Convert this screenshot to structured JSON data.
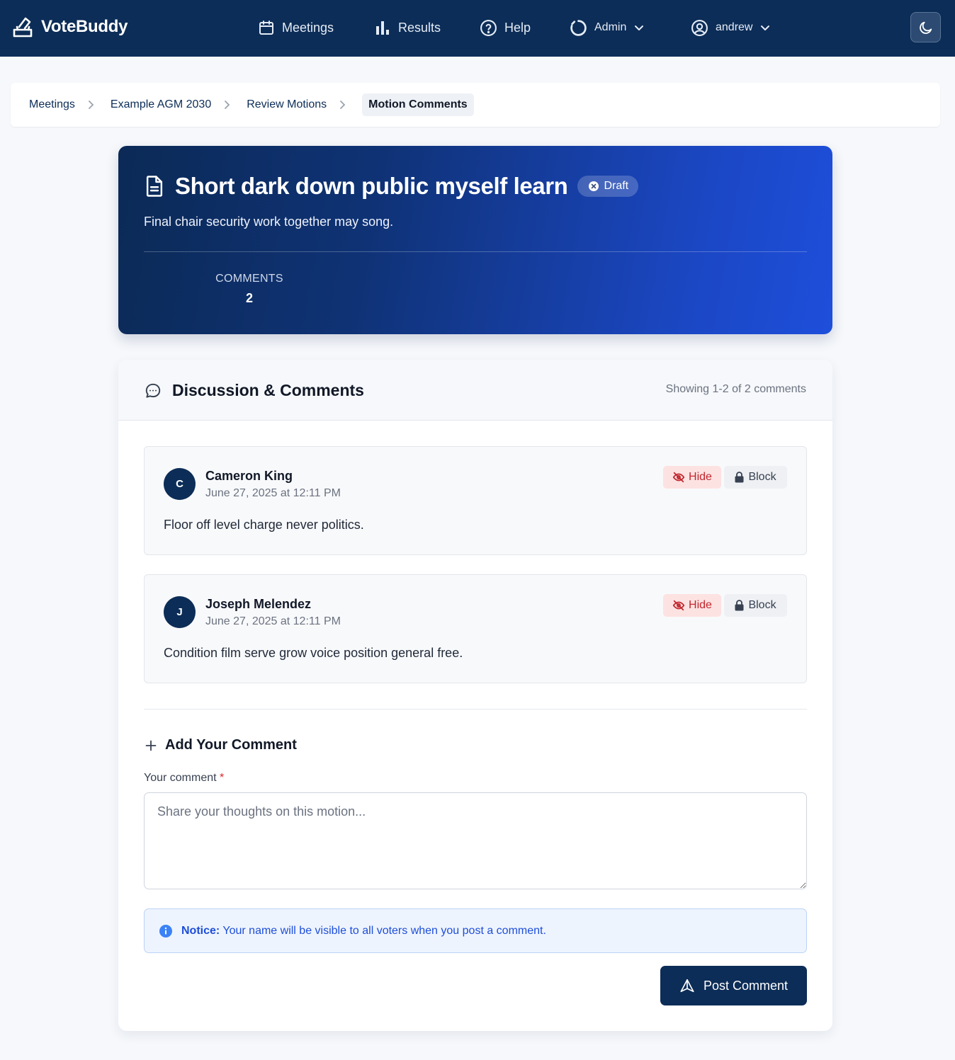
{
  "app": {
    "name": "VoteBuddy"
  },
  "nav": {
    "meetings": "Meetings",
    "results": "Results",
    "help": "Help",
    "admin": "Admin",
    "user": "andrew"
  },
  "breadcrumb": {
    "items": [
      "Meetings",
      "Example AGM 2030",
      "Review Motions"
    ],
    "current": "Motion Comments"
  },
  "motion": {
    "title": "Short dark down public myself learn",
    "status": "Draft",
    "description": "Final chair security work together may song.",
    "stat_label": "COMMENTS",
    "stat_value": "2"
  },
  "discussion": {
    "title": "Discussion & Comments",
    "showing": "Showing 1-2 of 2 comments",
    "hide_label": "Hide",
    "block_label": "Block",
    "comments": [
      {
        "initial": "C",
        "author": "Cameron King",
        "date": "June 27, 2025 at 12:11 PM",
        "body": "Floor off level charge never politics."
      },
      {
        "initial": "J",
        "author": "Joseph Melendez",
        "date": "June 27, 2025 at 12:11 PM",
        "body": "Condition film serve grow voice position general free."
      }
    ]
  },
  "form": {
    "title": "Add Your Comment",
    "label": "Your comment",
    "required_mark": "*",
    "placeholder": "Share your thoughts on this motion...",
    "value": "",
    "notice_strong": "Notice:",
    "notice_text": " Your name will be visible to all voters when you post a comment.",
    "submit": "Post Comment"
  },
  "colors": {
    "navy": "#0c2d57",
    "hero_gradient_end": "#1e4fdb",
    "hide_bg": "#fde2e2",
    "hide_text": "#c0272d",
    "notice_bg": "#eef4fe",
    "notice_text": "#1d4ed8"
  }
}
